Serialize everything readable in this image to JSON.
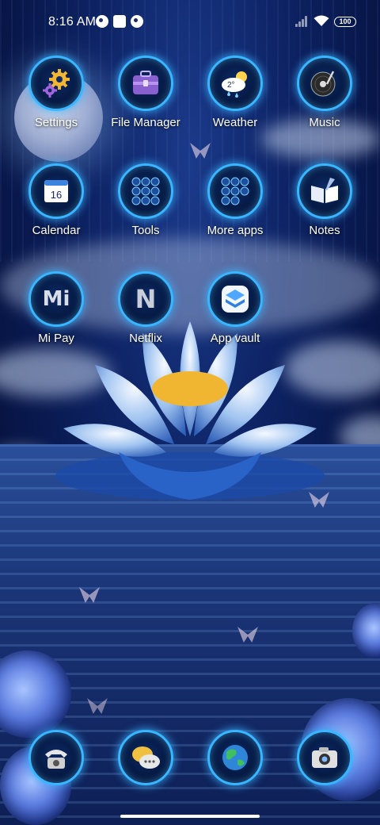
{
  "status_bar": {
    "time": "8:16 AM",
    "battery": "100",
    "icons": [
      "notification-pie-icon",
      "notification-square-icon",
      "notification-pie-icon",
      "signal-icon",
      "wifi-icon",
      "battery-icon"
    ]
  },
  "apps": [
    {
      "label": "Settings",
      "icon": "gear-icon",
      "glyph": "⚙",
      "color": "#f2b632"
    },
    {
      "label": "File Manager",
      "icon": "briefcase-icon",
      "glyph": "💼",
      "color": "#8a5fd0"
    },
    {
      "label": "Weather",
      "icon": "weather-cloud-icon",
      "glyph": "⛅",
      "color": "#ffffff",
      "sub": "2°"
    },
    {
      "label": "Music",
      "icon": "vinyl-record-icon",
      "glyph": "💿",
      "color": "#dddddd"
    },
    {
      "label": "Calendar",
      "icon": "calendar-icon",
      "glyph": "16",
      "color": "#ffffff"
    },
    {
      "label": "Tools",
      "icon": "tools-folder-icon",
      "glyph": "▦",
      "color": "#7fcfff"
    },
    {
      "label": "More apps",
      "icon": "more-apps-folder-icon",
      "glyph": "▦",
      "color": "#7fcfff"
    },
    {
      "label": "Notes",
      "icon": "notes-book-icon",
      "glyph": "📖",
      "color": "#ffffff"
    },
    {
      "label": "Mi Pay",
      "icon": "mi-pay-icon",
      "glyph": "Mi",
      "color": "#d8dde8"
    },
    {
      "label": "Netflix",
      "icon": "netflix-icon",
      "glyph": "N",
      "color": "#c9ced8"
    },
    {
      "label": "App vault",
      "icon": "app-vault-icon",
      "glyph": "◈",
      "color": "#5fb3ff"
    }
  ],
  "dock": [
    {
      "label": "Phone",
      "icon": "telephone-icon",
      "glyph": "☎",
      "color": "#e6e6e6"
    },
    {
      "label": "Messages",
      "icon": "chat-bubbles-icon",
      "glyph": "💬",
      "color": "#f0c040"
    },
    {
      "label": "Browser",
      "icon": "globe-icon",
      "glyph": "🌍",
      "color": "#3fbf5f"
    },
    {
      "label": "Camera",
      "icon": "camera-icon",
      "glyph": "📷",
      "color": "#e0e0e0"
    }
  ]
}
